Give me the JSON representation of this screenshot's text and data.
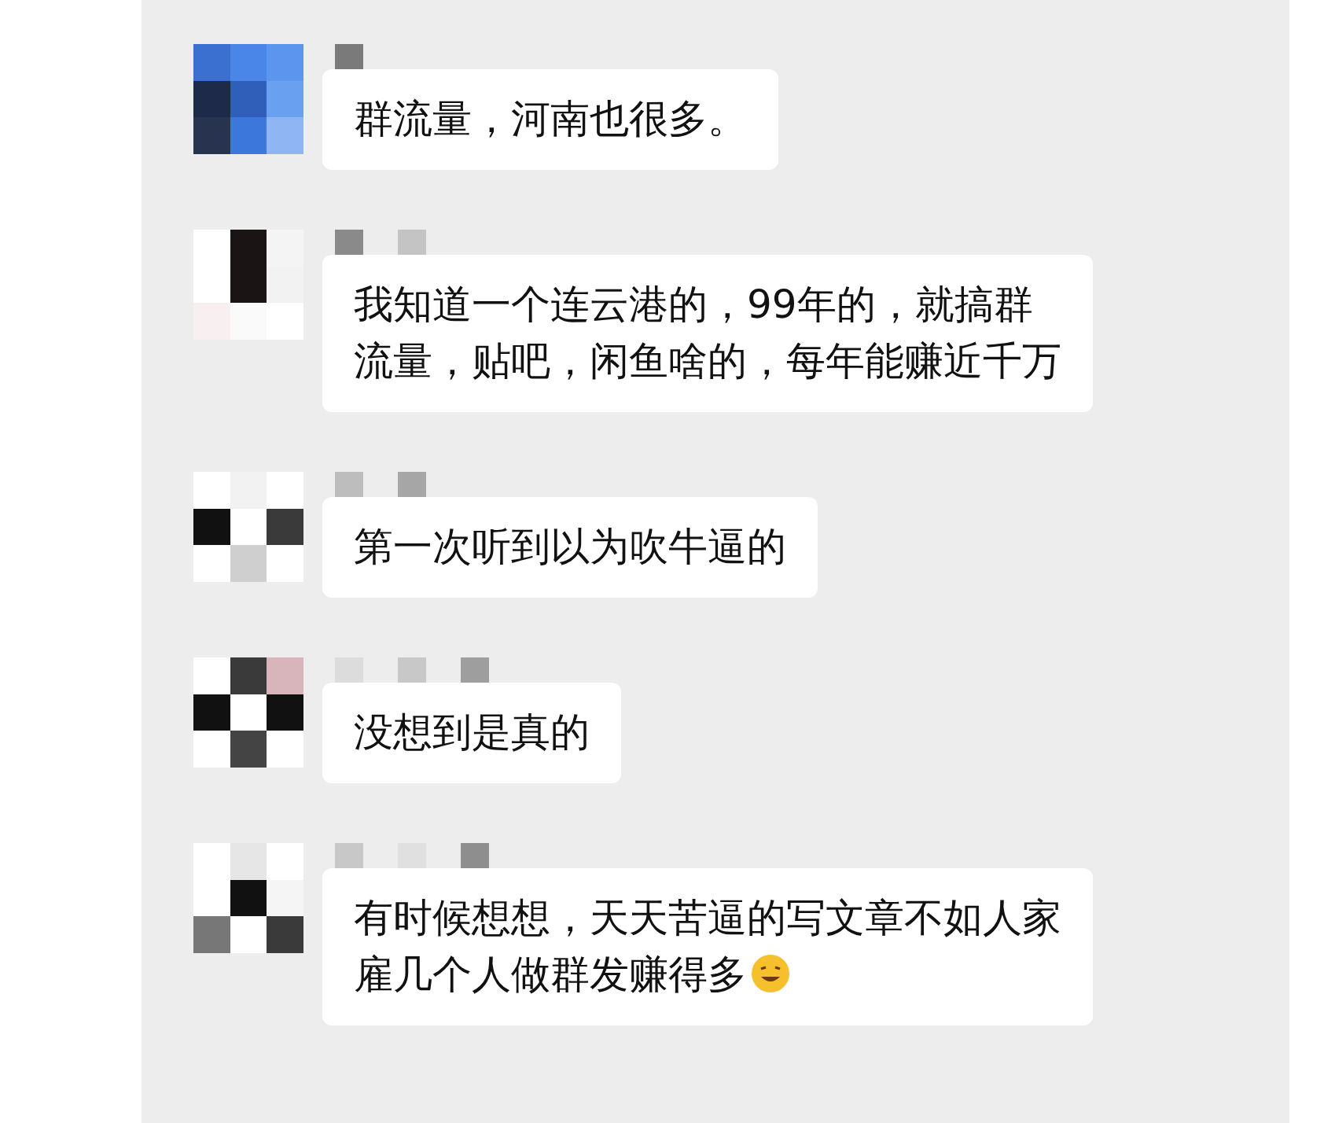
{
  "messages": [
    {
      "text": "群流量，河南也很多。",
      "trailing_emoji": false
    },
    {
      "text": "我知道一个连云港的，99年的，就搞群流量，贴吧，闲鱼啥的，每年能赚近千万",
      "trailing_emoji": false
    },
    {
      "text": "第一次听到以为吹牛逼的",
      "trailing_emoji": false
    },
    {
      "text": "没想到是真的",
      "trailing_emoji": false
    },
    {
      "text": "有时候想想，天天苦逼的写文章不如人家雇几个人做群发赚得多",
      "trailing_emoji": true
    }
  ]
}
